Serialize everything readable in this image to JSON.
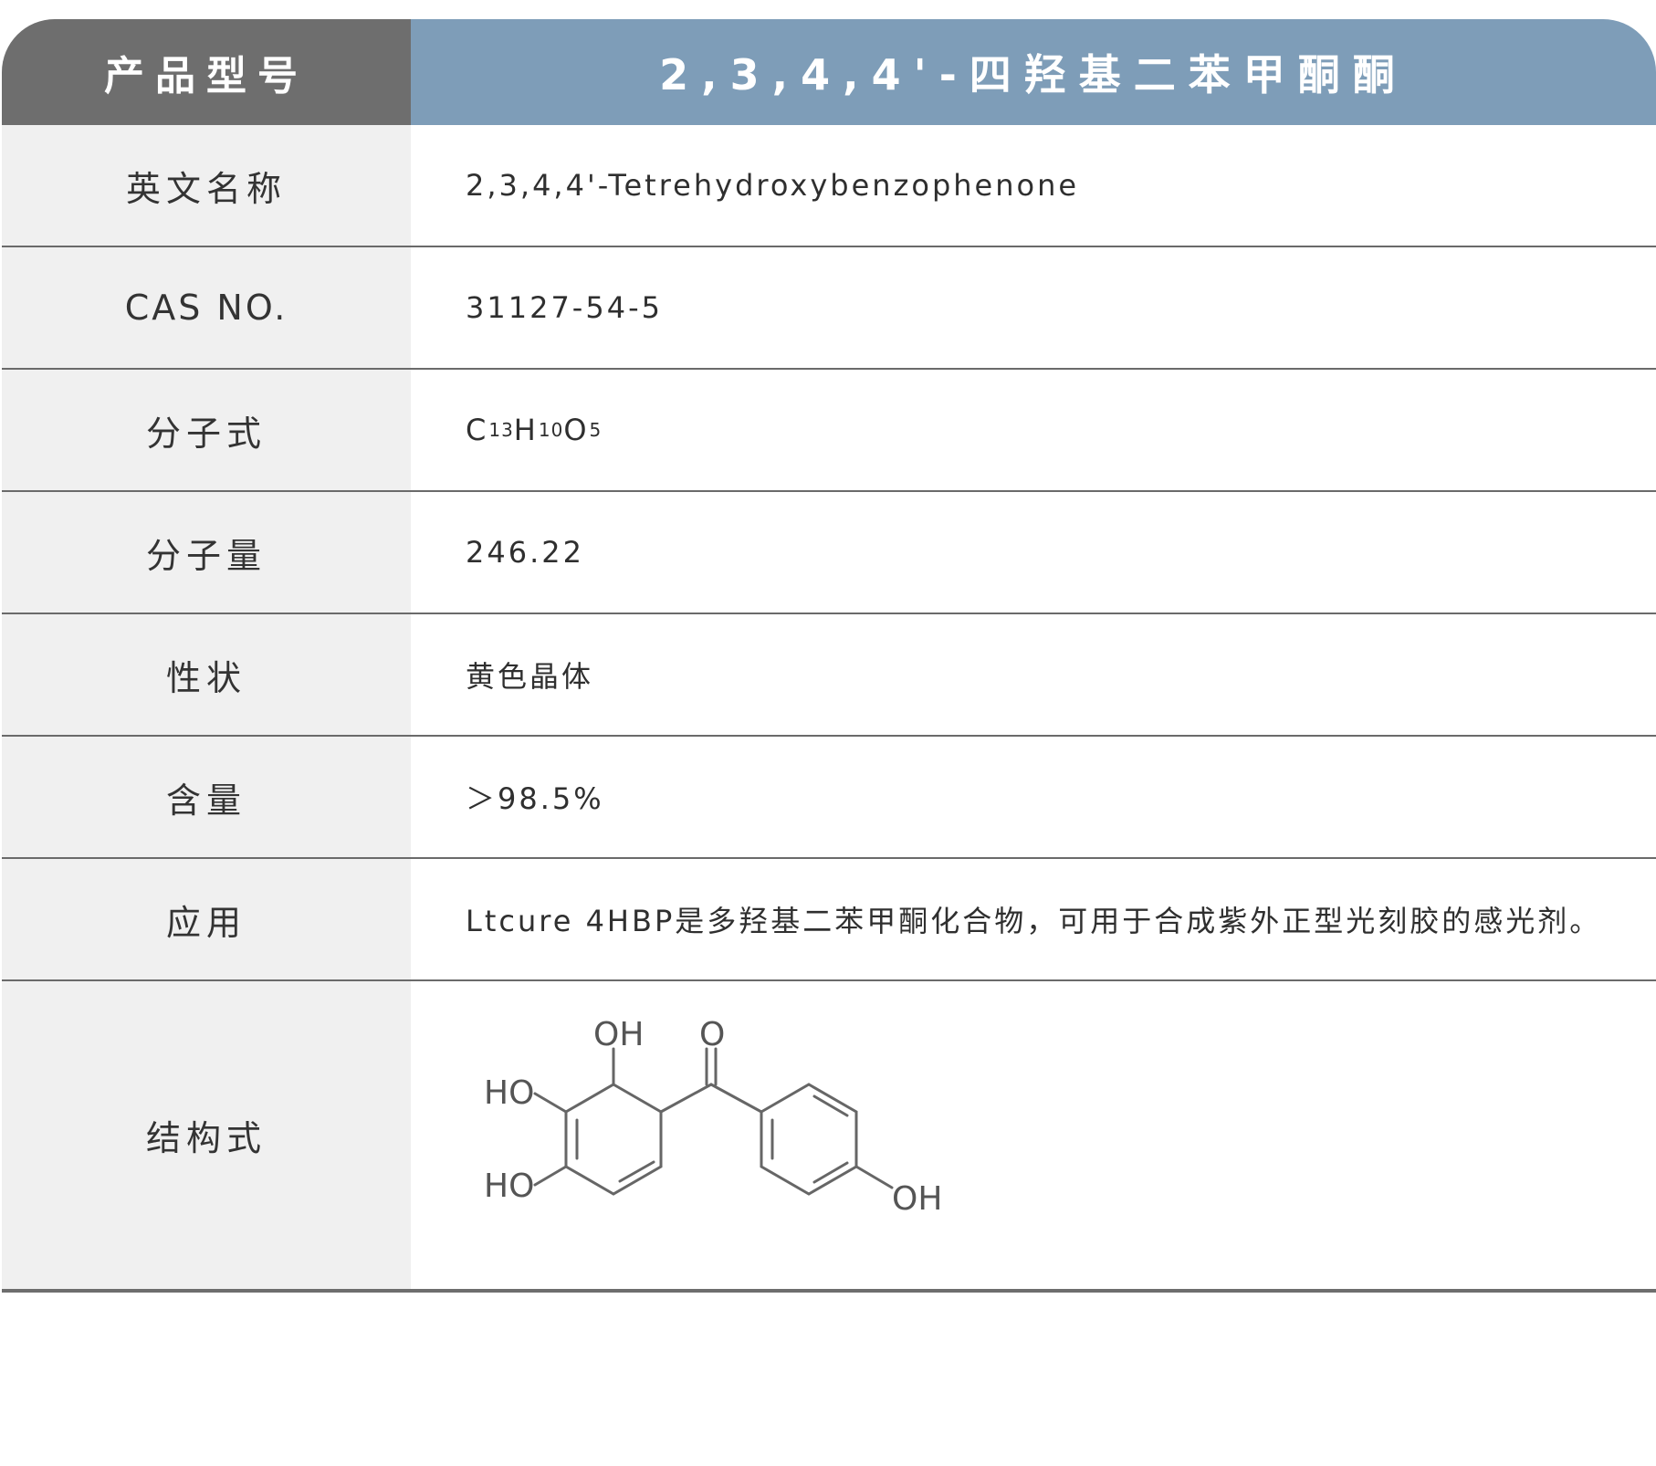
{
  "header": {
    "left_label": "产品型号",
    "product_name": "2,3,4,4'-四羟基二苯甲酮酮"
  },
  "rows": [
    {
      "label": "英文名称",
      "value": "2,3,4,4'-Tetrehydroxybenzophenone"
    },
    {
      "label": "CAS NO.",
      "value": "31127-54-5"
    },
    {
      "label": "分子式",
      "formula": [
        {
          "el": "C",
          "n": "13"
        },
        {
          "el": "H",
          "n": "10"
        },
        {
          "el": "O",
          "n": "5"
        }
      ]
    },
    {
      "label": "分子量",
      "value": "246.22"
    },
    {
      "label": "性状",
      "value": "黄色晶体"
    },
    {
      "label": "含量",
      "value": "＞98.5%"
    },
    {
      "label": "应用",
      "value": "Ltcure 4HBP是多羟基二苯甲酮化合物，可用于合成紫外正型光刻胶的感光剂。"
    },
    {
      "label": "结构式"
    }
  ],
  "structure": {
    "labels": {
      "oh_top": "OH",
      "carbonyl_o": "O",
      "ho_mid": "HO",
      "ho_bottom": "HO",
      "oh_para": "OH"
    },
    "line_color": "#666666"
  },
  "colors": {
    "header_left_bg": "#6e6e6e",
    "header_right_bg": "#7e9db8",
    "label_bg": "#f0f0f0",
    "divider": "#6a6a6a"
  }
}
